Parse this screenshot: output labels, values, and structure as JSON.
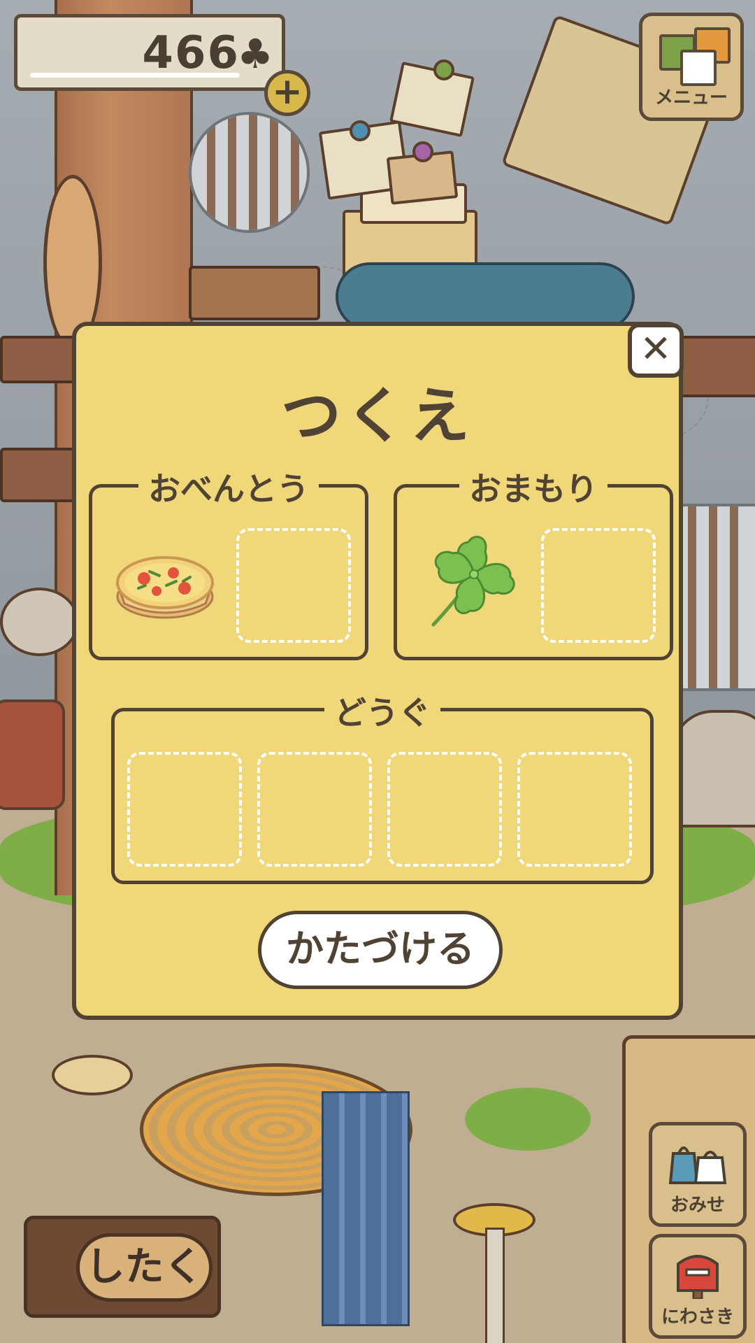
{
  "hud": {
    "clover_count": "466",
    "clover_symbol": "♣",
    "plus_symbol": "+",
    "menu_label": "メニュー"
  },
  "modal": {
    "title": "つくえ",
    "close_symbol": "✕",
    "lunch_group": {
      "label": "おべんとう",
      "slots": [
        {
          "filled": true,
          "item_icon": "quiche-icon"
        },
        {
          "filled": false
        }
      ]
    },
    "charm_group": {
      "label": "おまもり",
      "slots": [
        {
          "filled": true,
          "item_icon": "four-leaf-clover-icon"
        },
        {
          "filled": false
        }
      ]
    },
    "tools_group": {
      "label": "どうぐ",
      "slots": [
        {
          "filled": false
        },
        {
          "filled": false
        },
        {
          "filled": false
        },
        {
          "filled": false
        }
      ]
    },
    "tidy_button_label": "かたづける"
  },
  "side_buttons": {
    "shop_label": "おみせ",
    "garden_label": "にわさき"
  },
  "prep_button_label": "したく",
  "colors": {
    "modal_bg": "#efd77a",
    "outline": "#514334",
    "slot_dash": "#ffffff",
    "wood_button": "#d8bf8c"
  }
}
